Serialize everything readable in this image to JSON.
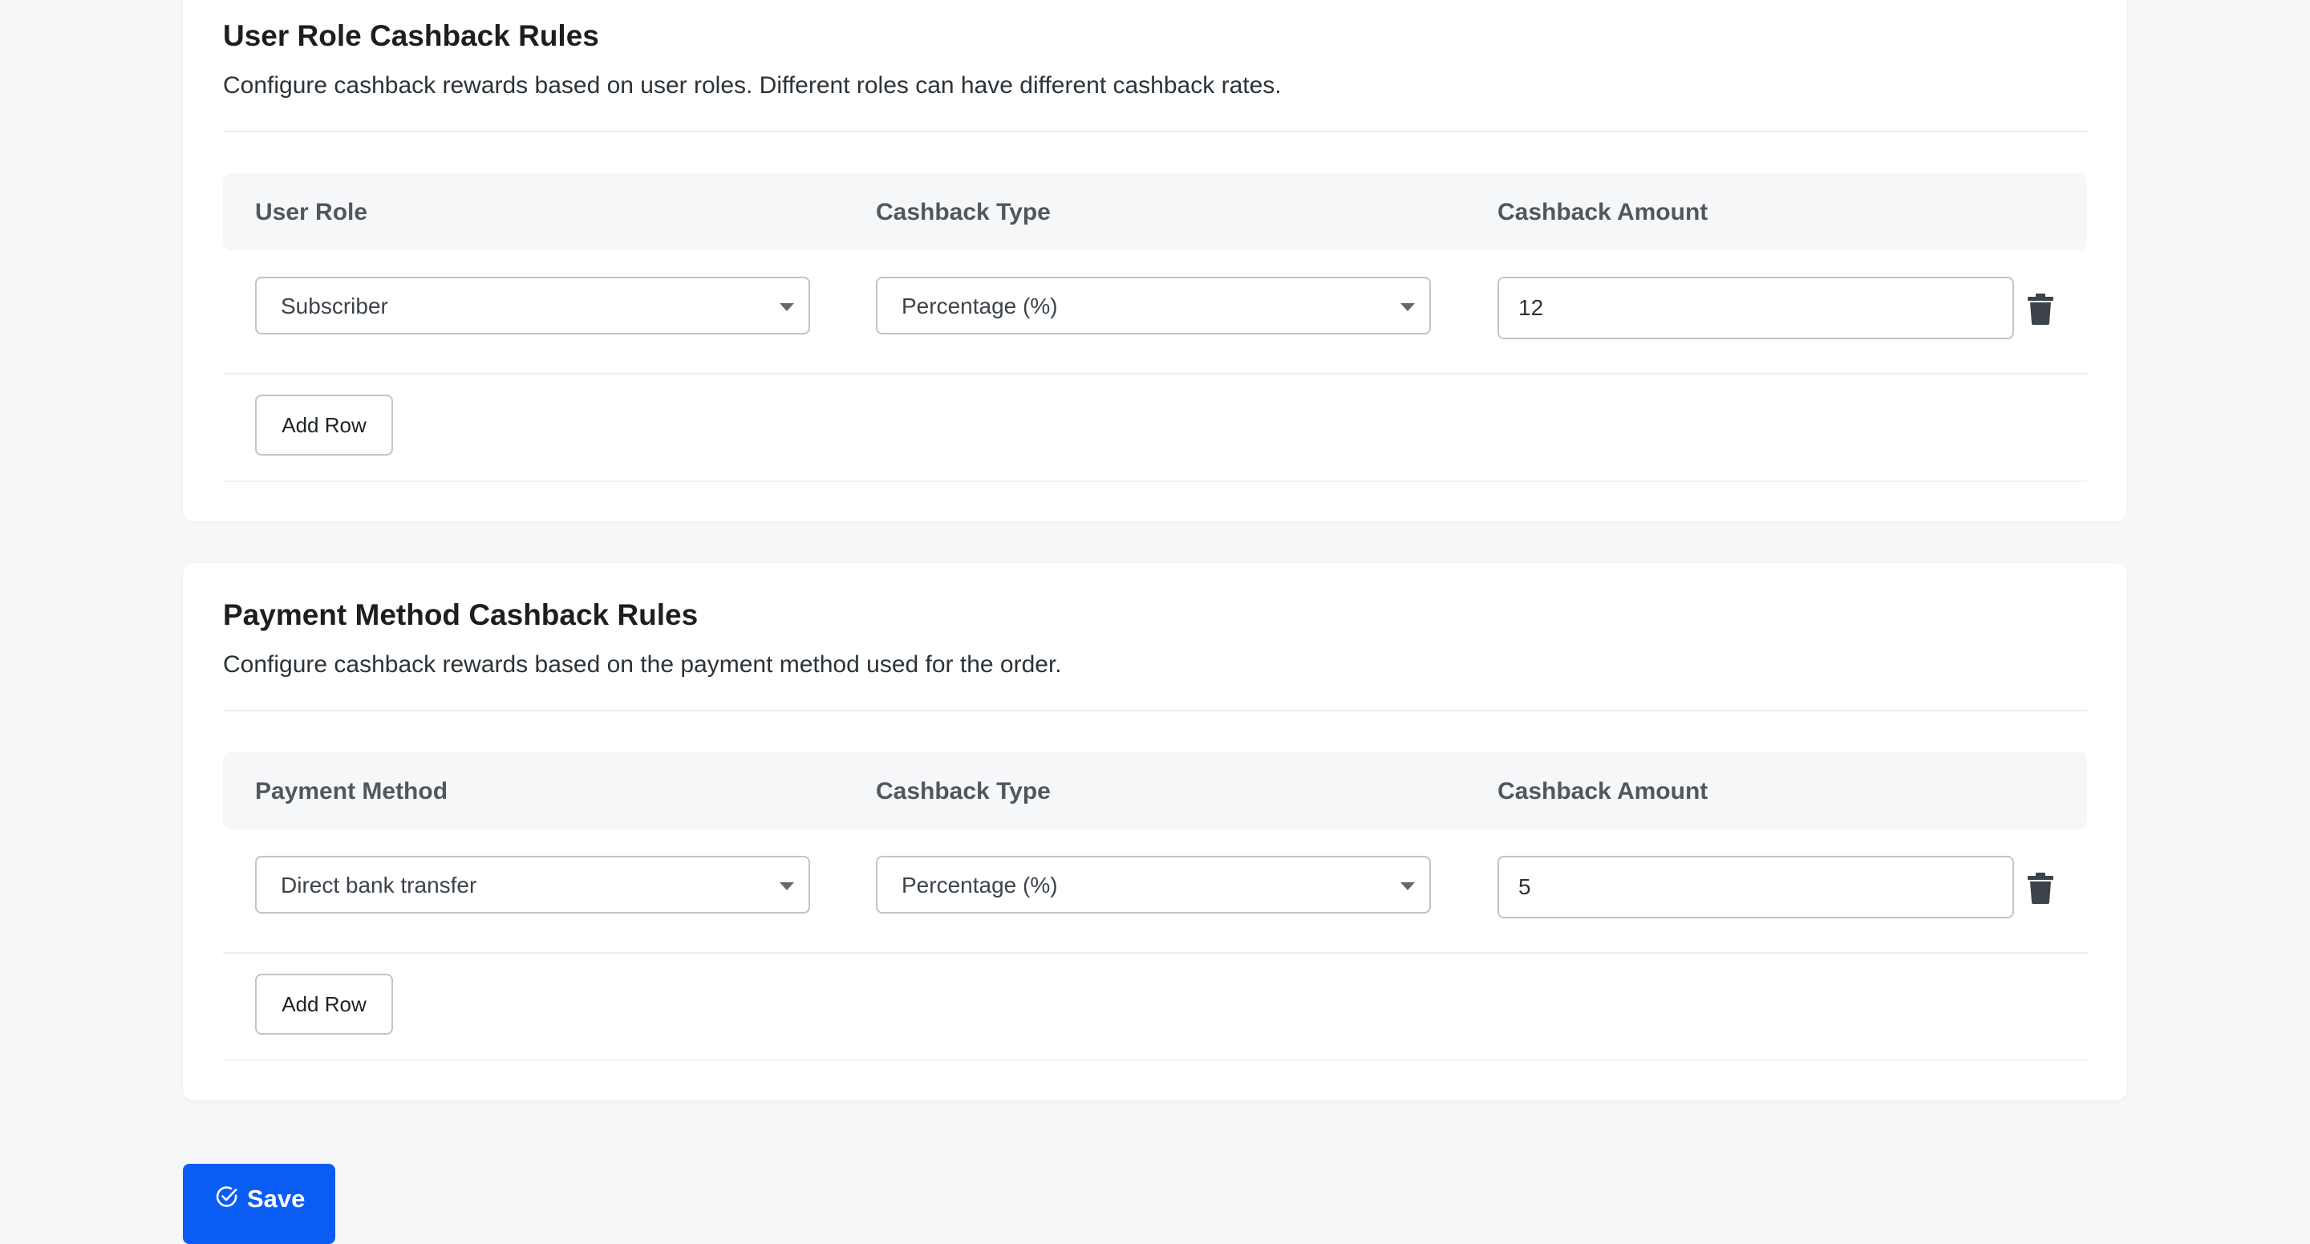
{
  "user_role_section": {
    "title": "User Role Cashback Rules",
    "description": "Configure cashback rewards based on user roles. Different roles can have different cashback rates.",
    "columns": [
      "User Role",
      "Cashback Type",
      "Cashback Amount"
    ],
    "rows": [
      {
        "role": "Subscriber",
        "cashback_type": "Percentage (%)",
        "amount": "12"
      }
    ],
    "add_row_label": "Add Row"
  },
  "payment_method_section": {
    "title": "Payment Method Cashback Rules",
    "description": "Configure cashback rewards based on the payment method used for the order.",
    "columns": [
      "Payment Method",
      "Cashback Type",
      "Cashback Amount"
    ],
    "rows": [
      {
        "method": "Direct bank transfer",
        "cashback_type": "Percentage (%)",
        "amount": "5"
      }
    ],
    "add_row_label": "Add Row"
  },
  "footer": {
    "save_label": "Save"
  },
  "icons": {
    "delete": "trash-icon",
    "save": "check-circle-icon",
    "dropdown": "caret-down-icon"
  },
  "colors": {
    "primary": "#0a5cf5",
    "background": "#f6f7f9",
    "card": "#ffffff",
    "border": "#c3c4c7",
    "trash": "#3c434a"
  }
}
